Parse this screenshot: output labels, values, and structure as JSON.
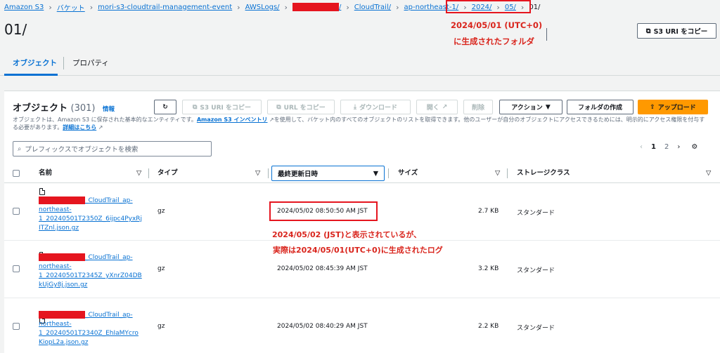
{
  "breadcrumb": [
    {
      "label": "Amazon S3"
    },
    {
      "label": "バケット"
    },
    {
      "label": "mori-s3-cloudtrail-management-event"
    },
    {
      "label": "AWSLogs/"
    },
    {
      "label": "/"
    },
    {
      "label": "CloudTrail/"
    },
    {
      "label": "ap-northeast-1/"
    },
    {
      "label": "2024/"
    },
    {
      "label": "05/"
    },
    {
      "label": "01/"
    }
  ],
  "page_title": "01/",
  "annotation_folder": [
    "2024/05/01 (UTC+0)",
    "に生成されたフォルダ"
  ],
  "copy_s3_uri_top": "S3 URI をコピー",
  "tabs": [
    {
      "label": "オブジェクト"
    },
    {
      "label": "プロパティ"
    }
  ],
  "objects": {
    "title": "オブジェクト",
    "count": "(301)",
    "info": "情報",
    "desc_1": "オブジェクトは、Amazon S3 に保存された基本的なエンティティです。",
    "desc_link_inventory": "Amazon S3 インベントリ",
    "desc_2": "を使用して、バケット内のすべてのオブジェクトのリストを取得できます。他のユーザーが自分のオブジェクトにアクセスできるためには、明示的にアクセス権限を付与する必要があります。",
    "desc_link_more": "詳細はこちら"
  },
  "toolbar": {
    "refresh": "↻",
    "copy_s3_uri": "S3 URI をコピー",
    "copy_url": "URL をコピー",
    "download": "ダウンロード",
    "open": "開く",
    "delete": "削除",
    "actions": "アクション",
    "create_folder": "フォルダの作成",
    "upload": "アップロード"
  },
  "search": {
    "placeholder": "プレフィックスでオブジェクトを検索"
  },
  "pager": {
    "page1": "1",
    "page2": "2"
  },
  "columns": {
    "name": "名前",
    "type": "タイプ",
    "modified": "最終更新日時",
    "size": "サイズ",
    "storage": "ストレージクラス"
  },
  "rows": [
    {
      "name_suffix": "_CloudTrail_ap-",
      "name_l2": "northeast-",
      "name_l3": "1_20240501T2350Z_6ijpc4PyxRj",
      "name_l4": "ITZnl.json.gz",
      "type": "gz",
      "modified": "2024/05/02 08:50:50 AM JST",
      "size": "2.7 KB",
      "storage": "スタンダード"
    },
    {
      "name_suffix": "_CloudTrail_ap-",
      "name_l2": "northeast-",
      "name_l3": "1_20240501T2345Z_yXnrZ04DB",
      "name_l4": "kUjGy8j.json.gz",
      "type": "gz",
      "modified": "2024/05/02 08:45:39 AM JST",
      "size": "3.2 KB",
      "storage": "スタンダード"
    },
    {
      "name_suffix": "_CloudTrail_ap-",
      "name_l2": "northeast-",
      "name_l3": "1_20240501T2340Z_EhIaMYcro",
      "name_l4": "KiopL2a.json.gz",
      "type": "gz",
      "modified": "2024/05/02 08:40:29 AM JST",
      "size": "2.2 KB",
      "storage": "スタンダード"
    }
  ],
  "annotation_log": [
    "2024/05/02 (JST)と表示されているが、",
    "実際は2024/05/01(UTC+0)に生成されたログ"
  ],
  "colors": {
    "link": "#0972d3",
    "annotation": "#d9251d",
    "primary": "#ff9900"
  }
}
